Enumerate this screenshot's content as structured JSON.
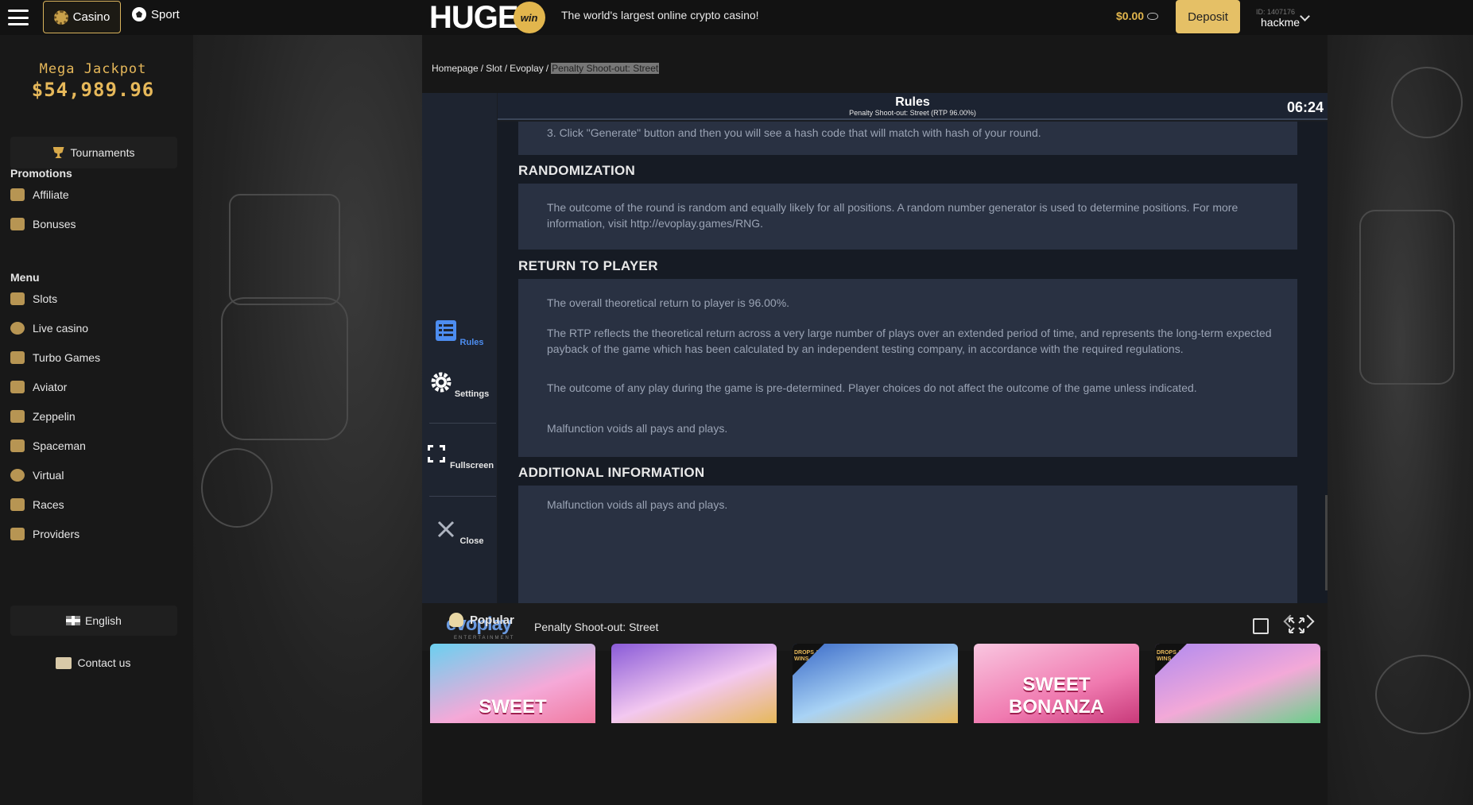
{
  "topbar": {
    "casino_label": "Casino",
    "sport_label": "Sport",
    "logo_text": "HUGE",
    "logo_badge": "win",
    "tagline": "The world's largest online crypto casino!",
    "balance": "$0.00",
    "deposit_label": "Deposit",
    "user_id": "ID: 1407176",
    "username": "hackme"
  },
  "sidebar": {
    "jackpot_title": "Mega Jackpot",
    "jackpot_value": "$54,989.96",
    "tournaments_label": "Tournaments",
    "promotions_title": "Promotions",
    "promotions": [
      {
        "label": "Affiliate"
      },
      {
        "label": "Bonuses"
      }
    ],
    "menu_title": "Menu",
    "menu": [
      {
        "label": "Slots"
      },
      {
        "label": "Live casino"
      },
      {
        "label": "Turbo Games"
      },
      {
        "label": "Aviator"
      },
      {
        "label": "Zeppelin"
      },
      {
        "label": "Spaceman"
      },
      {
        "label": "Virtual"
      },
      {
        "label": "Races"
      },
      {
        "label": "Providers"
      }
    ],
    "language": "English",
    "contact": "Contact us"
  },
  "breadcrumb": {
    "items": [
      "Homepage",
      "Slot",
      "Evoplay"
    ],
    "current": "Penalty Shoot-out: Street"
  },
  "game": {
    "side": {
      "rules": "Rules",
      "settings": "Settings",
      "fullscreen": "Fullscreen",
      "close": "Close"
    },
    "header": {
      "title": "Rules",
      "subtitle": "Penalty Shoot-out: Street (RTP 96.00%)",
      "timer": "06:24"
    },
    "rules": {
      "step3": "3. Click \"Generate\" button and then you will see a hash code that will match with hash of your round.",
      "randomization_title": "RANDOMIZATION",
      "randomization_text": "The outcome of the round is random and equally likely for all positions. A random number generator is used to determine positions. For more information, visit http://evoplay.games/RNG.",
      "rtp_title": "RETURN TO PLAYER",
      "rtp_p1": "The overall theoretical return to player is 96.00%.",
      "rtp_p2": "The RTP reflects the theoretical return across a very large number of plays over an extended period of time, and represents the long-term expected payback of the game which has been calculated by an independent testing company, in accordance with the required regulations.",
      "rtp_p3": "The outcome of any play during the game is pre-determined. Player choices do not affect the outcome of the game unless indicated.",
      "rtp_p4": "Malfunction voids all pays and plays.",
      "additional_title": "ADDITIONAL INFORMATION",
      "additional_p1": "Malfunction voids all pays and plays."
    },
    "footer": {
      "provider": "evoplay",
      "provider_sub": "ENTERTAINMENT",
      "name": "Penalty Shoot-out: Street"
    }
  },
  "popular": {
    "title": "Popular",
    "cards": [
      {
        "label": "SWEET",
        "badge": ""
      },
      {
        "label": "",
        "badge": ""
      },
      {
        "label": "",
        "badge": "DROPS & WINS"
      },
      {
        "label": "SWEET BONANZA",
        "badge": ""
      },
      {
        "label": "",
        "badge": "DROPS & WINS"
      }
    ]
  },
  "colors": {
    "accent": "#e5c066",
    "gold": "#e2b64d",
    "panel": "#293142"
  }
}
